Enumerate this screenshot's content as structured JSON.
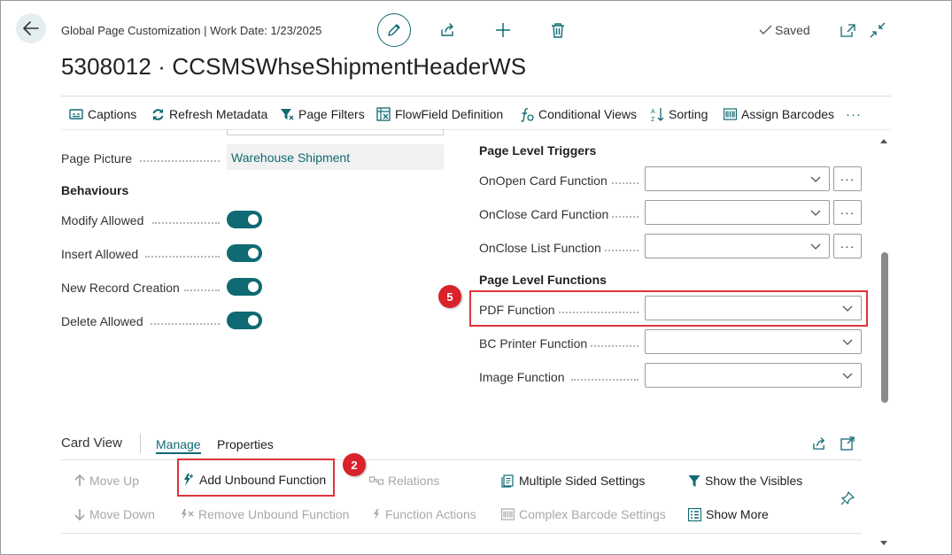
{
  "header": {
    "context": "Global Page Customization | Work Date: 1/23/2025",
    "title": "5308012 · CCSMSWhseShipmentHeaderWS",
    "saved": "Saved"
  },
  "toolbar": {
    "items": [
      {
        "label": "Captions",
        "icon": "captions-icon"
      },
      {
        "label": "Refresh Metadata",
        "icon": "refresh-icon"
      },
      {
        "label": "Page Filters",
        "icon": "filter-icon"
      },
      {
        "label": "FlowField Definition",
        "icon": "flowfield-icon"
      },
      {
        "label": "Conditional Views",
        "icon": "function-icon"
      },
      {
        "label": "Sorting",
        "icon": "sort-icon"
      },
      {
        "label": "Assign Barcodes",
        "icon": "barcode-icon"
      }
    ],
    "more": "···"
  },
  "left": {
    "page_picture_label": "Page Picture",
    "page_picture_value": "Warehouse Shipment",
    "behaviours_heading": "Behaviours",
    "toggles": [
      {
        "label": "Modify Allowed",
        "on": true
      },
      {
        "label": "Insert Allowed",
        "on": true
      },
      {
        "label": "New Record Creation",
        "on": true
      },
      {
        "label": "Delete Allowed",
        "on": true
      }
    ]
  },
  "right": {
    "triggers_heading": "Page Level Triggers",
    "triggers": [
      {
        "label": "OnOpen Card Function",
        "value": ""
      },
      {
        "label": "OnClose Card Function",
        "value": ""
      },
      {
        "label": "OnClose List Function",
        "value": ""
      }
    ],
    "functions_heading": "Page Level Functions",
    "functions": [
      {
        "label": "PDF Function",
        "value": ""
      },
      {
        "label": "BC Printer Function",
        "value": ""
      },
      {
        "label": "Image Function",
        "value": ""
      }
    ],
    "more_label": "···"
  },
  "card_view": {
    "title": "Card View",
    "tabs": [
      {
        "label": "Manage",
        "active": true
      },
      {
        "label": "Properties",
        "active": false
      }
    ],
    "actions_row1": [
      {
        "label": "Move Up",
        "enabled": false
      },
      {
        "label": "Add Unbound Function",
        "enabled": true
      },
      {
        "label": "Relations",
        "enabled": false
      },
      {
        "label": "Multiple Sided Settings",
        "enabled": true
      },
      {
        "label": "Show the Visibles",
        "enabled": true
      }
    ],
    "actions_row2": [
      {
        "label": "Move Down",
        "enabled": false
      },
      {
        "label": "Remove Unbound Function",
        "enabled": false
      },
      {
        "label": "Function Actions",
        "enabled": false
      },
      {
        "label": "Complex Barcode Settings",
        "enabled": false
      },
      {
        "label": "Show More",
        "enabled": true
      }
    ]
  },
  "callouts": {
    "badge_pdf": "5",
    "badge_add": "2"
  },
  "colors": {
    "accent": "#0f6a73",
    "highlight": "#e0333a",
    "badge": "#d9222a"
  }
}
